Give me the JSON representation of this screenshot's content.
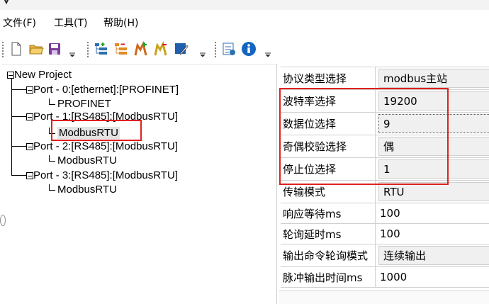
{
  "menu": {
    "items": [
      {
        "label": "文件(F)"
      },
      {
        "label": "工具(T)"
      },
      {
        "label": "帮助(H)"
      }
    ]
  },
  "toolbar": {
    "group1": [
      "new-file-icon",
      "open-folder-icon",
      "save-icon"
    ],
    "group2": [
      "add-port-icon",
      "remove-port-icon",
      "add-device-icon",
      "remove-device-icon",
      "edit-icon"
    ],
    "group3": [
      "properties-icon",
      "info-icon"
    ]
  },
  "tree": {
    "root": "New Project",
    "ports": [
      {
        "label": "Port - 0:[ethernet]:[PROFINET]",
        "child": "PROFINET"
      },
      {
        "label": "Port - 1:[RS485]:[ModbusRTU]",
        "child": "ModbusRTU"
      },
      {
        "label": "Port - 2:[RS485]:[ModbusRTU]",
        "child": "ModbusRTU"
      },
      {
        "label": "Port - 3:[RS485]:[ModbusRTU]",
        "child": "ModbusRTU"
      }
    ]
  },
  "properties": [
    {
      "name": "协议类型选择",
      "value": "modbus主站"
    },
    {
      "name": "波特率选择",
      "value": "19200"
    },
    {
      "name": "数据位选择",
      "value": "9"
    },
    {
      "name": "奇偶校验选择",
      "value": "偶"
    },
    {
      "name": "停止位选择",
      "value": "1"
    },
    {
      "name": "传输模式",
      "value": "RTU"
    },
    {
      "name": "响应等待ms",
      "value": "100"
    },
    {
      "name": "轮询延时ms",
      "value": "100"
    },
    {
      "name": "输出命令轮询模式",
      "value": "连续输出"
    },
    {
      "name": "脉冲输出时间ms",
      "value": "1000"
    }
  ],
  "colors": {
    "highlight_border": "#e02020",
    "selection_bg": "#e3e3e3",
    "combo_bg": "#f0f0f0"
  }
}
